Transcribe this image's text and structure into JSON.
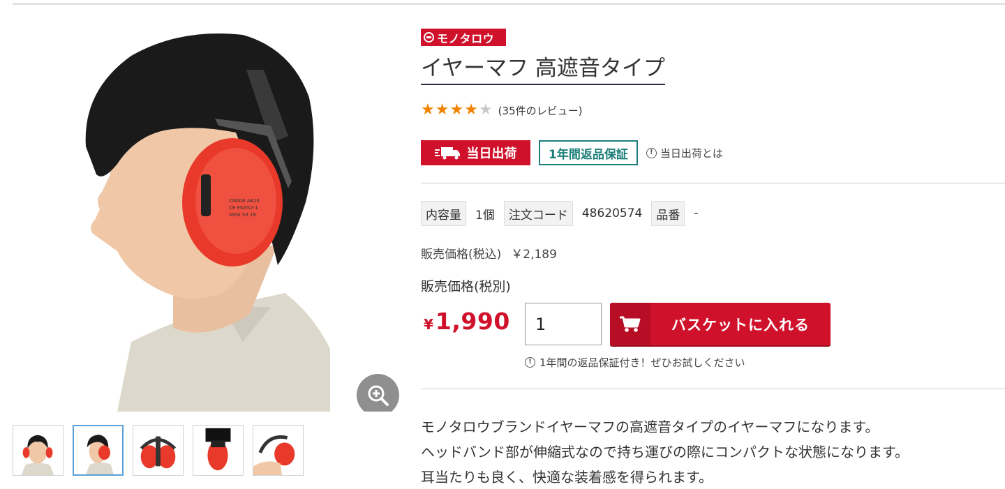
{
  "product": {
    "brand": "モノタロウ",
    "title": "イヤーマフ 高遮音タイプ",
    "rating": 4,
    "rating_max": 5,
    "review_count_text": "(35件のレビュー)",
    "badges": {
      "same_day": "当日出荷",
      "return_guarantee": "1年間返品保証",
      "same_day_help": "当日出荷とは"
    },
    "specs": [
      {
        "label": "内容量",
        "value": "1個"
      },
      {
        "label": "注文コード",
        "value": "48620574"
      },
      {
        "label": "品番",
        "value": "-"
      }
    ],
    "price_incl_label": "販売価格(税込)",
    "price_incl_value": "￥2,189",
    "price_excl_label": "販売価格(税別)",
    "price_currency": "¥",
    "price_amount": "1,990",
    "quantity": "1",
    "cart_button": "バスケットに入れる",
    "guarantee_note": "1年間の返品保証付き！ぜひお試しください",
    "description": [
      "モノタロウブランドイヤーマフの高遮音タイプのイヤーマフになります。",
      "ヘッドバンド部が伸縮式なので持ち運びの際にコンパクトな状態になります。",
      "耳当たりも良く、快適な装着感を得られます。"
    ]
  },
  "gallery": {
    "thumbnail_count": 5,
    "active_index": 1
  },
  "colors": {
    "brand_red": "#d0112b",
    "return_teal": "#1c7e7a",
    "star_on": "#f08200",
    "star_off": "#c9c9c9",
    "earmuff_red": "#e8392a"
  },
  "icons": [
    "zoom-in-icon",
    "truck-icon",
    "info-icon",
    "cart-icon",
    "star-icon"
  ]
}
